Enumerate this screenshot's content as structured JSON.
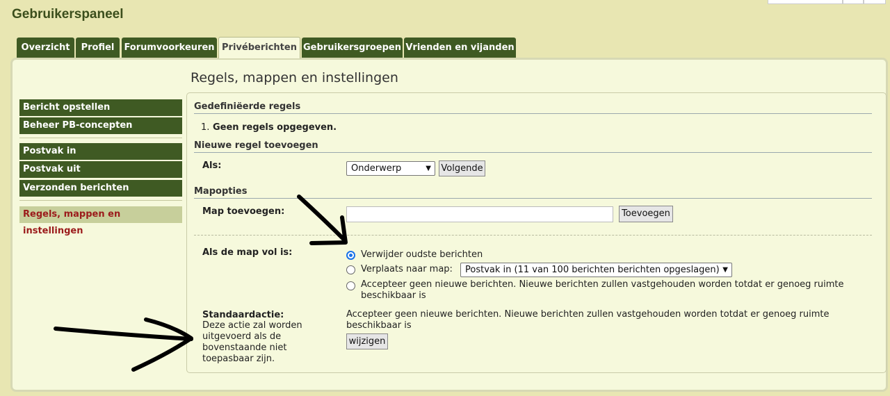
{
  "header": {
    "title": "Gebruikerspaneel"
  },
  "tabs": [
    {
      "label": "Overzicht"
    },
    {
      "label": "Profiel"
    },
    {
      "label": "Forumvoorkeuren"
    },
    {
      "label": "Privéberichten"
    },
    {
      "label": "Gebruikersgroepen"
    },
    {
      "label": "Vrienden en vijanden"
    }
  ],
  "page": {
    "subtitle": "Regels, mappen en instellingen"
  },
  "sidebar": {
    "items": [
      {
        "label": "Bericht opstellen"
      },
      {
        "label": "Beheer PB-concepten"
      },
      {
        "label": "Postvak in"
      },
      {
        "label": "Postvak uit"
      },
      {
        "label": "Verzonden berichten"
      },
      {
        "label": "Regels, mappen en instellingen"
      }
    ]
  },
  "rules": {
    "heading": "Gedefiniëerde regels",
    "empty_number": "1.",
    "empty_text": "Geen regels opgegeven."
  },
  "new_rule": {
    "heading": "Nieuwe regel toevoegen",
    "label": "Als:",
    "select_value": "Onderwerp",
    "button": "Volgende"
  },
  "folders": {
    "heading": "Mapopties",
    "add_label": "Map toevoegen:",
    "add_input_value": "",
    "add_button": "Toevoegen",
    "full_label": "Als de map vol is:",
    "option_delete": "Verwijder oudste berichten",
    "option_move": "Verplaats naar map:",
    "move_select_value": "Postvak in (11 van 100 berichten berichten opgeslagen)",
    "option_reject": "Accepteer geen nieuwe berichten. Nieuwe berichten zullen vastgehouden worden totdat er genoeg ruimte beschikbaar is",
    "selected_option": "delete",
    "default_label": "Standaardactie:",
    "default_desc": "Deze actie zal worden uitgevoerd als de bovenstaande niet toepasbaar zijn.",
    "default_value": "Accepteer geen nieuwe berichten. Nieuwe berichten zullen vastgehouden worden totdat er genoeg ruimte beschikbaar is",
    "change_button": "wijzigen"
  }
}
